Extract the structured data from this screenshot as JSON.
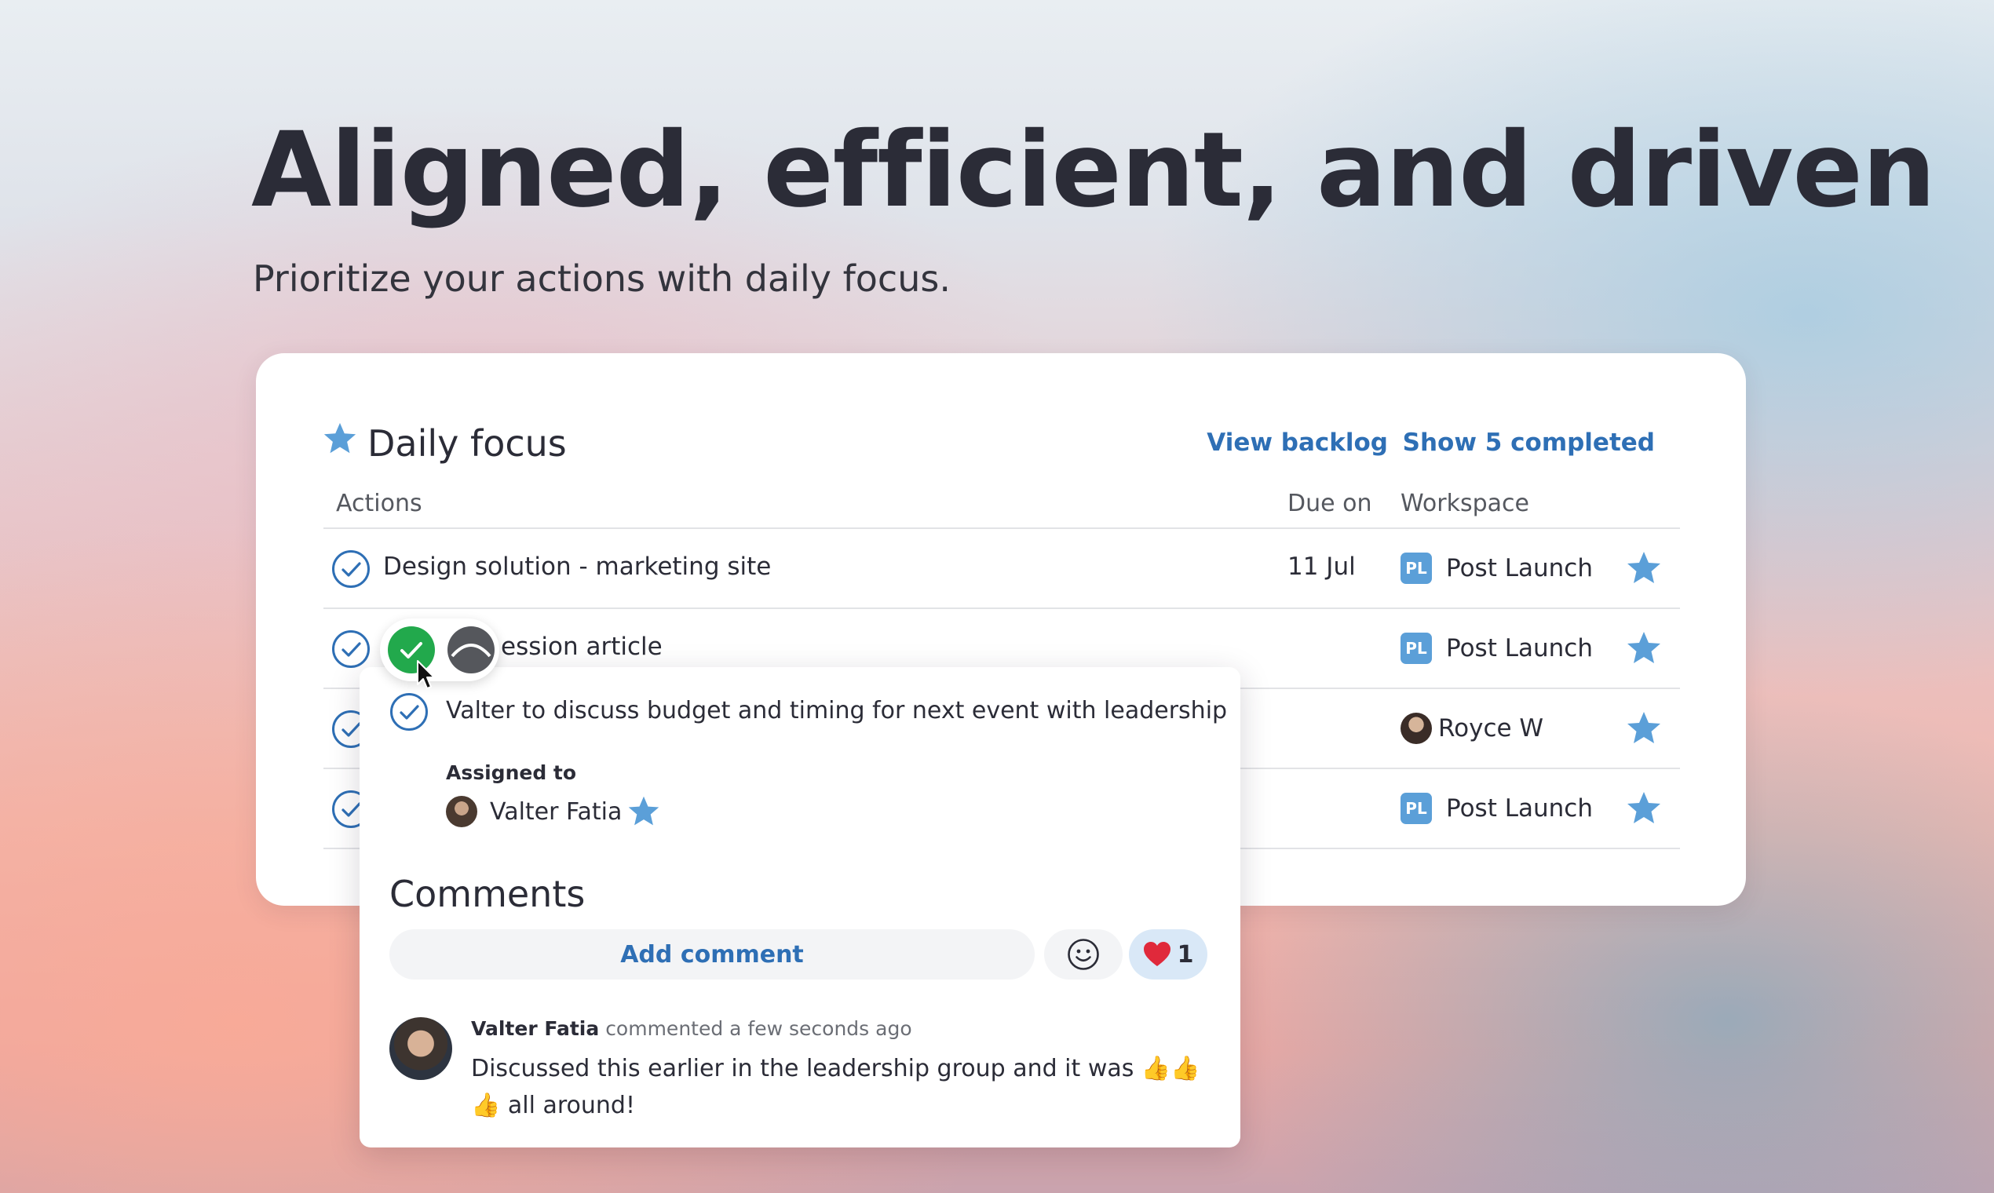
{
  "hero": {
    "title": "Aligned, efficient, and driven",
    "subtitle": "Prioritize your actions with daily focus."
  },
  "card": {
    "title": "Daily focus",
    "links": {
      "view_backlog": "View backlog",
      "show_completed": "Show 5 completed"
    },
    "columns": {
      "actions": "Actions",
      "due": "Due on",
      "workspace": "Workspace"
    },
    "rows": [
      {
        "title": "Design solution - marketing site",
        "due": "11 Jul",
        "workspace_badge": "PL",
        "workspace": "Post Launch"
      },
      {
        "title": "ession article",
        "due": "",
        "workspace_badge": "PL",
        "workspace": "Post Launch"
      },
      {
        "title": "",
        "due": "",
        "workspace_badge": "",
        "workspace": "Royce W"
      },
      {
        "title": "",
        "due": "",
        "workspace_badge": "PL",
        "workspace": "Post Launch"
      }
    ]
  },
  "popup": {
    "title": "Valter to discuss budget and timing for next event with leadership",
    "assigned_label": "Assigned to",
    "assignee": "Valter Fatia",
    "comments_title": "Comments",
    "add_comment": "Add comment",
    "reaction_count": "1",
    "comment": {
      "author": "Valter Fatia",
      "meta": "commented a few seconds ago",
      "text": "Discussed this earlier in the leadership group and it was 👍👍👍 all around!"
    }
  },
  "colors": {
    "accent_blue": "#2e6fb5",
    "star_blue": "#5b9fd8",
    "done_green": "#22a94c",
    "reaction_bg": "#d9e8f7"
  },
  "icons": {
    "check": "check-circle-icon",
    "star": "star-icon",
    "smiley": "smiley-icon",
    "heart": "heart-icon",
    "cursor": "cursor-icon"
  }
}
